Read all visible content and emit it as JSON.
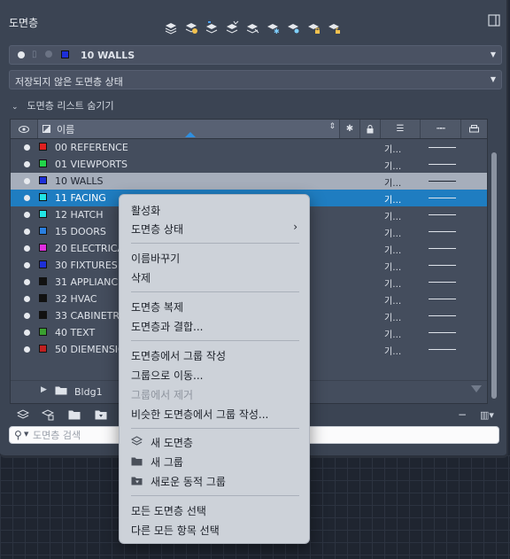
{
  "palette": {
    "title": "도면층",
    "current_layer": {
      "name": "10 WALLS",
      "color": "#1d2fd8"
    },
    "layer_state": "저장되지 않은 도면층 상태",
    "hide_list_label": "도면층 리스트 숨기기",
    "columns": {
      "name": "이름"
    },
    "rows": [
      {
        "name": "00 REFERENCE",
        "color": "#e02020",
        "linetype": "기…"
      },
      {
        "name": "01 VIEWPORTS",
        "color": "#22d44a",
        "linetype": "기…"
      },
      {
        "name": "10 WALLS",
        "color": "#1d2fd8",
        "linetype": "기…",
        "state": "highlighted"
      },
      {
        "name": "11 FACING",
        "color": "#22e4e4",
        "linetype": "기…",
        "state": "selected"
      },
      {
        "name": "12 HATCH",
        "color": "#22e4e4",
        "linetype": "기…"
      },
      {
        "name": "15 DOORS",
        "color": "#2a7fe0",
        "linetype": "기…"
      },
      {
        "name": "20 ELECTRICA",
        "color": "#e02ee0",
        "linetype": "기…"
      },
      {
        "name": "30 FIXTURES",
        "color": "#1d2fd8",
        "linetype": "기…"
      },
      {
        "name": "31 APPLIANCE",
        "color": "#111111",
        "linetype": "기…"
      },
      {
        "name": "32 HVAC",
        "color": "#111111",
        "linetype": "기…"
      },
      {
        "name": "33 CABINETR",
        "color": "#111111",
        "linetype": "기…"
      },
      {
        "name": "40 TEXT",
        "color": "#3aa030",
        "linetype": "기…"
      },
      {
        "name": "50 DIEMENSIO",
        "color": "#c02020",
        "linetype": "기…"
      }
    ],
    "group": {
      "name": "Bldg1"
    },
    "search_placeholder": "도면층 검색"
  },
  "context_menu": {
    "activate": "활성화",
    "layer_state": "도면층 상태",
    "rename": "이름바꾸기",
    "delete": "삭제",
    "duplicate": "도면층 복제",
    "merge": "도면층과 결합...",
    "create_group": "도면층에서 그룹 작성",
    "move_to_group": "그룹으로 이동...",
    "remove_from_group": "그룹에서 제거",
    "create_group_similar": "비슷한 도면층에서 그룹 작성...",
    "new_layer": "새 도면층",
    "new_group": "새 그룹",
    "new_dynamic_group": "새로운 동적 그룹",
    "select_all": "모든 도면층 선택",
    "select_others": "다른 모든 항목 선택"
  }
}
